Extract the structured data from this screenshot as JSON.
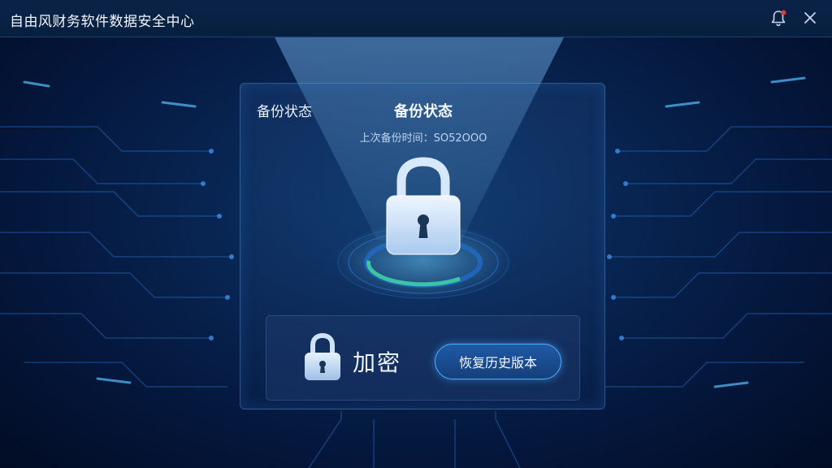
{
  "app": {
    "title": "自由风财务软件数据安全中心"
  },
  "titlebar": {
    "notify_icon": "bell-icon",
    "close_icon": "close-icon"
  },
  "panel": {
    "corner_label": "备份状态",
    "title": "备份状态",
    "last_backup": "上次备份时间：SO52OOO"
  },
  "actions": {
    "encrypt_label": "加密",
    "restore_label": "恢复历史版本",
    "lock_icon": "lock-icon"
  },
  "colors": {
    "background": "#04163a",
    "accent": "#4fb0ff",
    "notification_dot": "#e53935",
    "ring_green": "#3fd6a0"
  }
}
